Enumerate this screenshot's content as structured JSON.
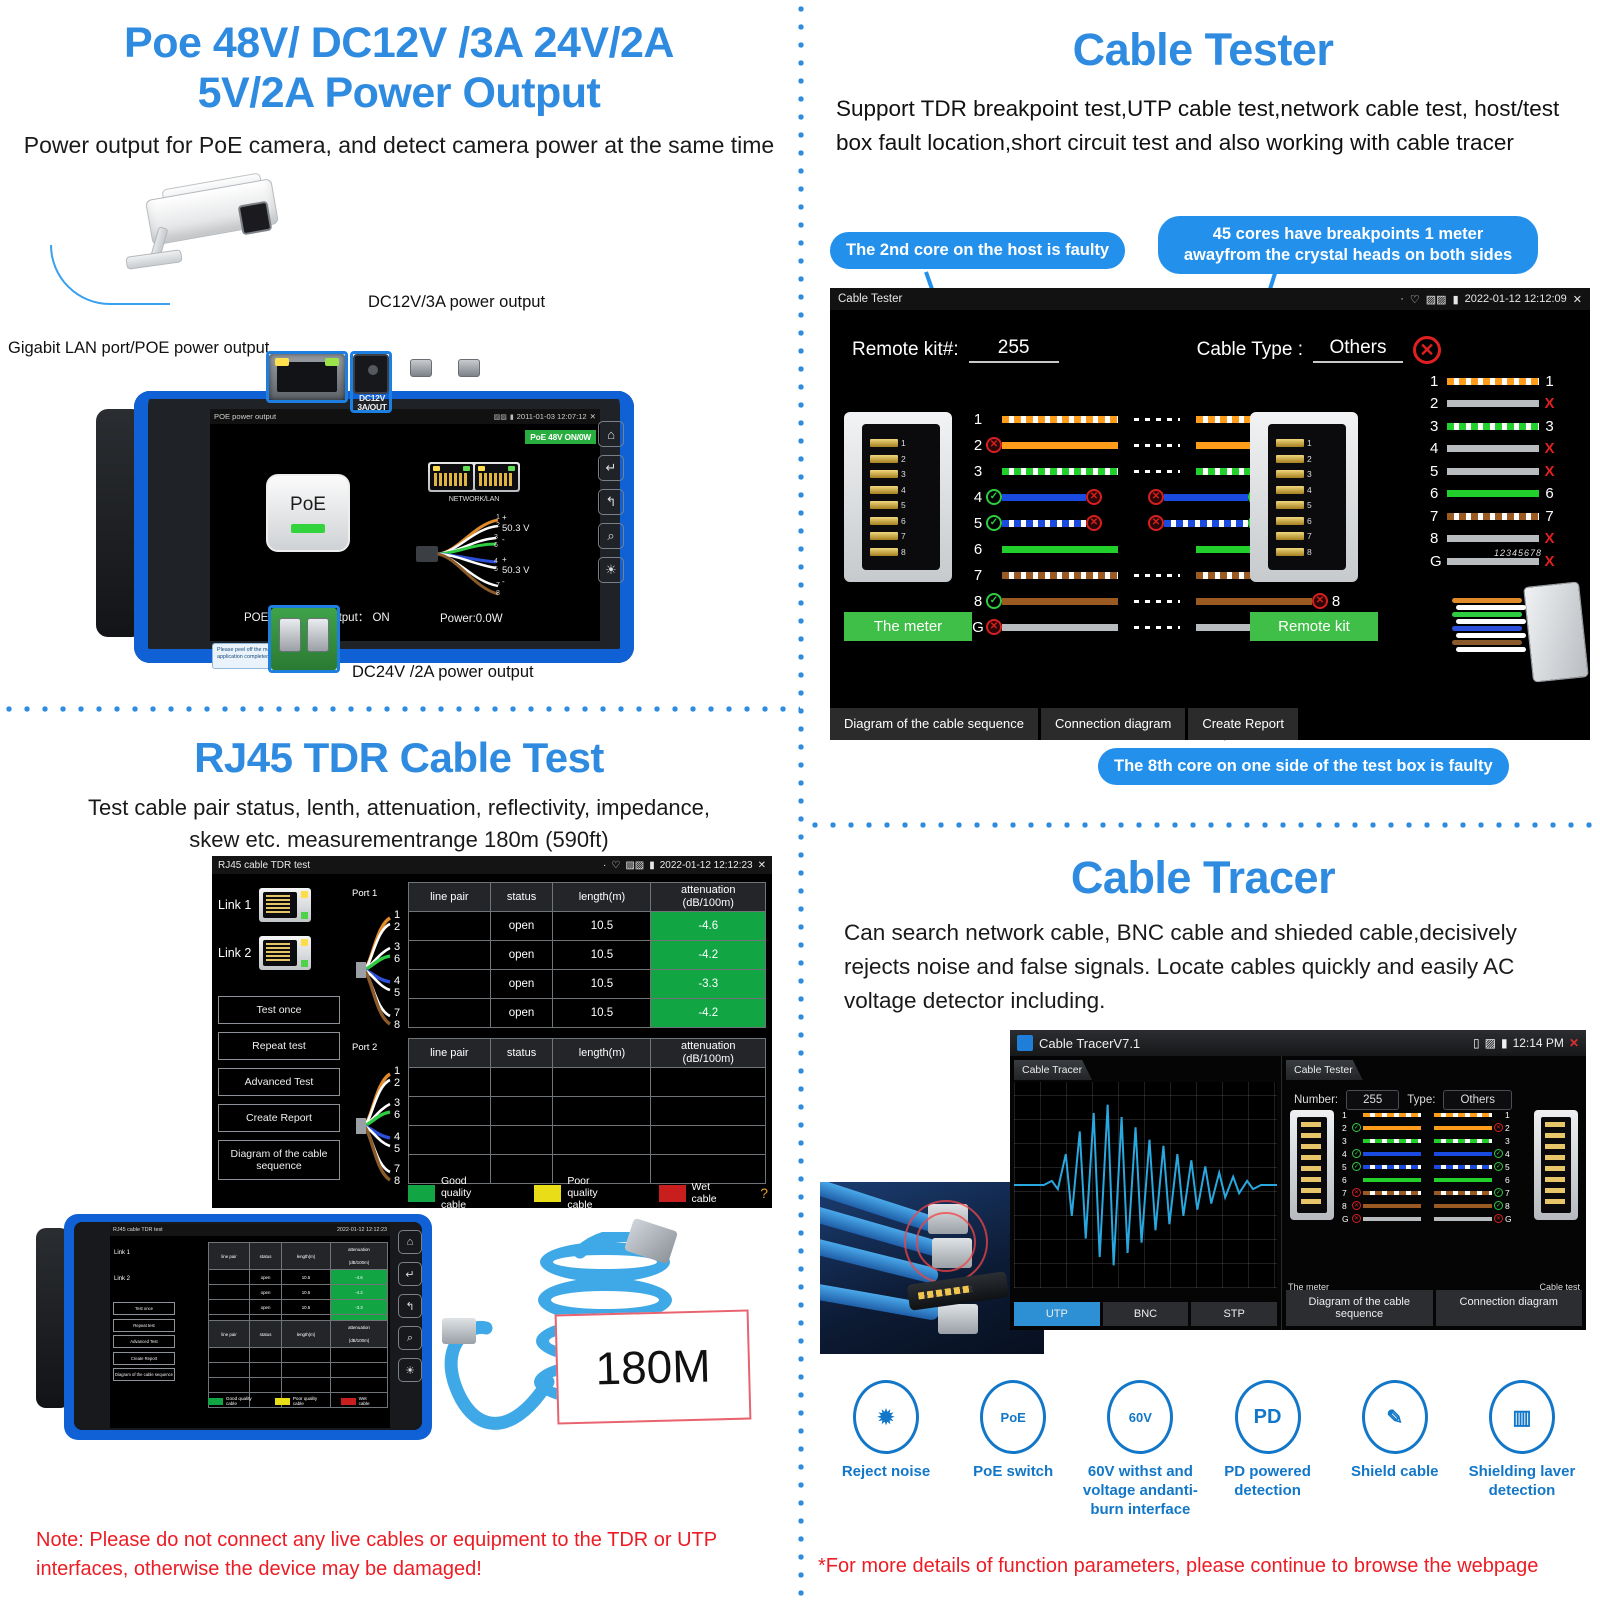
{
  "top_left": {
    "title_line1": "Poe  48V/ DC12V /3A  24V/2A",
    "title_line2": "5V/2A  Power Output",
    "subtitle": "Power output for PoE camera, and detect camera power at the same time",
    "label_lan": "Gigabit LAN port/POE power output",
    "label_dc12": "DC12V/3A power output",
    "label_dc24": "DC24V /2A  power output",
    "jack_label": "DC12V 3A/OUT",
    "screen": {
      "window_title": "POE power output",
      "timestamp": "2011-01-03 12:07:12",
      "close": "✕",
      "badge": "PoE 48V ON/0W",
      "poe_button": "PoE",
      "net_label": "NETWORK/LAN",
      "volt_top": "50.3 V",
      "volt_bottom": "50.3 V",
      "plus": "+",
      "minus": "-",
      "power_output_label": "POE/DC power output：",
      "power_output_value": "ON",
      "power_reading": "Power:0.0W",
      "pins_left": [
        "1",
        "2",
        "3",
        "6",
        "4",
        "5",
        "7",
        "8"
      ],
      "side_buttons": [
        "home-icon",
        "enter-icon",
        "back-icon",
        "zoom-icon",
        "light-icon"
      ],
      "sticker": "Please peel off the mask AFTER application completed"
    }
  },
  "top_right": {
    "title": "Cable Tester",
    "subtitle": "Support TDR breakpoint test,UTP cable test,network cable test, host/test box fault location,short circuit test and also working with cable tracer",
    "callout_1": "The 2nd core on the host is faulty",
    "callout_2": "45 cores have breakpoints 1 meter awayfrom the crystal heads on both sides",
    "callout_3": "The 8th core on one side of the test box is faulty",
    "screen": {
      "window_title": "Cable Tester",
      "timestamp": "2022-01-12 12:12:09",
      "close": "✕",
      "remote_kit_label": "Remote kit#:",
      "remote_kit_value": "255",
      "cable_type_label": "Cable Type :",
      "cable_type_value": "Others",
      "meter_button": "The meter",
      "remote_button": "Remote kit",
      "foot_buttons": [
        "Diagram of the cable sequence",
        "Connection diagram",
        "Create Report"
      ],
      "rj45_pin_numbers": "12345678",
      "pin_rows": [
        {
          "pin": "1",
          "color": "orgw",
          "left_mark": "none",
          "right_mark": "none",
          "broken": true
        },
        {
          "pin": "2",
          "color": "org",
          "left_mark": "bad",
          "right_mark": "ok",
          "broken": true
        },
        {
          "pin": "3",
          "color": "grnw",
          "left_mark": "none",
          "right_mark": "none",
          "broken": true
        },
        {
          "pin": "4",
          "color": "blu",
          "left_mark": "ok",
          "right_mark": "ok",
          "broken": true,
          "inner_marks": true
        },
        {
          "pin": "5",
          "color": "bluw",
          "left_mark": "ok",
          "right_mark": "ok",
          "broken": true,
          "inner_marks": true
        },
        {
          "pin": "6",
          "color": "grn",
          "left_mark": "none",
          "right_mark": "none",
          "broken": false
        },
        {
          "pin": "7",
          "color": "brnw",
          "left_mark": "none",
          "right_mark": "none",
          "broken": true
        },
        {
          "pin": "8",
          "color": "brn",
          "left_mark": "ok",
          "right_mark": "bad",
          "broken": true
        },
        {
          "pin": "G",
          "color": "gry",
          "left_mark": "bad",
          "right_mark": "bad",
          "broken": true
        }
      ],
      "summary_rows": [
        {
          "n": "1",
          "color": "orgw",
          "end": "1",
          "end_type": "num"
        },
        {
          "n": "2",
          "color": "gry",
          "end": "X",
          "end_type": "x"
        },
        {
          "n": "3",
          "color": "grnw",
          "end": "3",
          "end_type": "num"
        },
        {
          "n": "4",
          "color": "gry",
          "end": "X",
          "end_type": "x"
        },
        {
          "n": "5",
          "color": "gry",
          "end": "X",
          "end_type": "x"
        },
        {
          "n": "6",
          "color": "grn",
          "end": "6",
          "end_type": "num"
        },
        {
          "n": "7",
          "color": "brnw",
          "end": "7",
          "end_type": "num"
        },
        {
          "n": "8",
          "color": "gry",
          "end": "X",
          "end_type": "x"
        },
        {
          "n": "G",
          "color": "gry",
          "end": "X",
          "end_type": "x"
        }
      ]
    }
  },
  "bottom_left": {
    "title": "RJ45 TDR Cable  Test",
    "subtitle_line1": "Test cable pair status, lenth, attenuation, reflectivity, impedance,",
    "subtitle_line2": "skew etc. measurementrange 180m (590ft)",
    "tag": "180M",
    "note": "Note: Please do not connect any live cables or equipment to the TDR or UTP interfaces, otherwise the device may be damaged!",
    "screen": {
      "window_title": "RJ45 cable TDR test",
      "timestamp": "2022-01-12 12:12:23",
      "close": "✕",
      "link1": "Link 1",
      "link2": "Link 2",
      "port1": "Port 1",
      "port2": "Port 2",
      "columns": [
        "line pair",
        "status",
        "length(m)",
        "attenuation\n(dB/100m)"
      ],
      "col_linepair": "line pair",
      "col_status": "status",
      "col_length": "length(m)",
      "col_att_1": "attenuation",
      "col_att_2": "(dB/100m)",
      "port1_rows": [
        {
          "pair": "1/2",
          "status": "open",
          "length": "10.5",
          "attenuation": "-4.6"
        },
        {
          "pair": "3/6",
          "status": "open",
          "length": "10.5",
          "attenuation": "-4.2"
        },
        {
          "pair": "4/5",
          "status": "open",
          "length": "10.5",
          "attenuation": "-3.3"
        },
        {
          "pair": "7/8",
          "status": "open",
          "length": "10.5",
          "attenuation": "-4.2"
        }
      ],
      "port2_rows": [
        {
          "pair": "1/2",
          "status": "",
          "length": "",
          "attenuation": ""
        },
        {
          "pair": "3/6",
          "status": "",
          "length": "",
          "attenuation": ""
        },
        {
          "pair": "4/5",
          "status": "",
          "length": "",
          "attenuation": ""
        },
        {
          "pair": "7/8",
          "status": "",
          "length": "",
          "attenuation": ""
        }
      ],
      "buttons": [
        "Test once",
        "Repeat test",
        "Advanced Test",
        "Create Report",
        "Diagram of the cable sequence"
      ],
      "legend": [
        {
          "label": "Good quality cable",
          "color": "#11a544"
        },
        {
          "label": "Poor quality cable",
          "color": "#e8dd16"
        },
        {
          "label": "Wet cable",
          "color": "#c81e1e"
        }
      ]
    }
  },
  "bottom_right": {
    "title": "Cable Tracer",
    "subtitle": "Can search network cable, BNC cable and shieded cable,decisively rejects noise and false signals. Locate cables quickly and easily AC voltage detector including.",
    "screen": {
      "window_title": "Cable TracerV7.1",
      "time": "12:14 PM",
      "close": "✕",
      "tab_left": "Cable Tracer",
      "tab_right": "Cable Tester",
      "left_buttons": [
        "UTP",
        "BNC",
        "STP"
      ],
      "right_buttons": [
        "Diagram of the cable sequence",
        "Connection diagram"
      ],
      "number_label": "Number:",
      "number_value": "255",
      "type_label": "Type:",
      "type_value": "Others",
      "meter_label": "The meter",
      "cable_test_label": "Cable test",
      "pin_rows": [
        {
          "pin": "1",
          "color": "orgw",
          "left_mark": "none",
          "right_mark": "none"
        },
        {
          "pin": "2",
          "color": "org",
          "left_mark": "ok",
          "right_mark": "bad"
        },
        {
          "pin": "3",
          "color": "grnw",
          "left_mark": "none",
          "right_mark": "none"
        },
        {
          "pin": "4",
          "color": "blu",
          "left_mark": "ok",
          "right_mark": "ok"
        },
        {
          "pin": "5",
          "color": "bluw",
          "left_mark": "ok",
          "right_mark": "ok"
        },
        {
          "pin": "6",
          "color": "grn",
          "left_mark": "none",
          "right_mark": "none"
        },
        {
          "pin": "7",
          "color": "brnw",
          "left_mark": "bad",
          "right_mark": "ok"
        },
        {
          "pin": "8",
          "color": "brn",
          "left_mark": "bad",
          "right_mark": "ok"
        },
        {
          "pin": "G",
          "color": "gry",
          "left_mark": "bad",
          "right_mark": "bad"
        }
      ]
    },
    "features": [
      {
        "icon": "noise-reject-icon",
        "glyph": "✹",
        "label": "Reject noise"
      },
      {
        "icon": "poe-switch-icon",
        "glyph": "PoE",
        "label": "PoE switch"
      },
      {
        "icon": "voltage-shield-icon",
        "glyph": "60V",
        "label": "60V withst and voltage andanti-burn interface"
      },
      {
        "icon": "pd-detect-icon",
        "glyph": "PD",
        "label": "PD powered detection"
      },
      {
        "icon": "shield-cable-icon",
        "glyph": "✎",
        "label": "Shield cable"
      },
      {
        "icon": "shield-layer-icon",
        "glyph": "▥",
        "label": "Shielding laver detection"
      }
    ],
    "note": "*For more details of function parameters, please continue to browse the webpage"
  },
  "colors": {
    "accent_blue": "#2E8BE0",
    "note_red": "#ED1C24",
    "green_ok": "#11a544",
    "icon_blue": "#1277C8"
  }
}
